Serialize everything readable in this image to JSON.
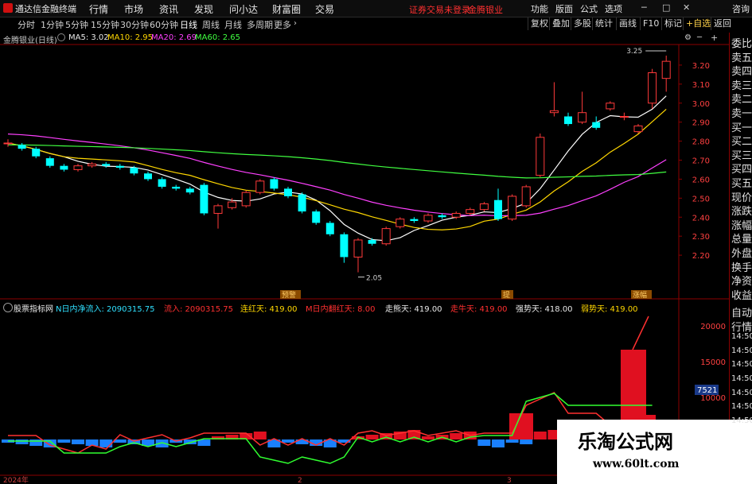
{
  "menubar": {
    "app_title": "通达信金融终端",
    "items": [
      "行情",
      "市场",
      "资讯",
      "发现",
      "问小达",
      "财富圈",
      "交易"
    ],
    "warning": "证券交易未登录",
    "stock_name": "金腾银业",
    "right_items": [
      "功能",
      "版面",
      "公式",
      "选项"
    ],
    "window_controls": [
      "─",
      "□",
      "✕"
    ],
    "right_label": "咨询"
  },
  "toolbar": {
    "periods": [
      "分时",
      "1分钟",
      "5分钟",
      "15分钟",
      "30分钟",
      "60分钟",
      "日线",
      "周线",
      "月线",
      "多周期",
      "更多"
    ],
    "active_period": "日线",
    "tools": [
      "复权",
      "叠加",
      "多股",
      "统计",
      "画线",
      "F10",
      "标记",
      "+自选",
      "返回"
    ]
  },
  "infobar": {
    "title": "金腾银业(日线)",
    "ma5": "MA5: 3.02",
    "ma10": "MA10: 2.95",
    "ma20": "MA20: 2.69",
    "ma60": "MA60: 2.65"
  },
  "price_axis": [
    "3.20",
    "3.10",
    "3.00",
    "2.90",
    "2.80",
    "2.70",
    "2.60",
    "2.50",
    "2.40",
    "2.30",
    "2.20"
  ],
  "annotations": {
    "high": "3.25",
    "low": "2.05",
    "tags": [
      "预警",
      "提",
      "涨幅"
    ]
  },
  "right_panel": [
    "委比",
    "卖五",
    "卖四",
    "卖三",
    "卖二",
    "卖一",
    "买一",
    "买二",
    "买三",
    "买四",
    "买五",
    "现价",
    "涨跌",
    "涨幅",
    "总量",
    "外盘",
    "换手",
    "净资",
    "收益"
  ],
  "indicator": {
    "title": "股票指标网",
    "items": [
      {
        "label": "N日内净流入:",
        "value": "2090315.75",
        "color": "cyan"
      },
      {
        "label": "流入:",
        "value": "2090315.75",
        "color": "red"
      },
      {
        "label": "连红天:",
        "value": "419.00",
        "color": "yel"
      },
      {
        "label": "M日内翻红天:",
        "value": "8.00",
        "color": "red"
      },
      {
        "label": "走熊天:",
        "value": "419.00",
        "color": "wht"
      },
      {
        "label": "走牛天:",
        "value": "419.00",
        "color": "red"
      },
      {
        "label": "强势天:",
        "value": "418.00",
        "color": "wht"
      },
      {
        "label": "弱势天:",
        "value": "419.00",
        "color": "yel"
      }
    ],
    "axis": [
      "20000",
      "15000",
      "10000",
      "5000"
    ],
    "current": "7521"
  },
  "side_panel2": [
    "自动",
    "行情",
    "14:50",
    "14:50",
    "14:50",
    "14:50",
    "14:50",
    "14:50",
    "14:50"
  ],
  "date_axis": [
    "2024年",
    "2",
    "3"
  ],
  "watermark": {
    "line1": "乐淘公式网",
    "line2": "www.60lt.com"
  },
  "chart_data": {
    "type": "candlestick",
    "ylim": [
      2.1,
      3.3
    ],
    "candles": [
      [
        2.79,
        2.79,
        2.81,
        2.77
      ],
      [
        2.78,
        2.76,
        2.79,
        2.75
      ],
      [
        2.76,
        2.72,
        2.77,
        2.71
      ],
      [
        2.71,
        2.67,
        2.72,
        2.66
      ],
      [
        2.67,
        2.65,
        2.68,
        2.64
      ],
      [
        2.65,
        2.67,
        2.68,
        2.64
      ],
      [
        2.67,
        2.68,
        2.69,
        2.66
      ],
      [
        2.68,
        2.67,
        2.69,
        2.66
      ],
      [
        2.67,
        2.66,
        2.68,
        2.65
      ],
      [
        2.66,
        2.63,
        2.67,
        2.62
      ],
      [
        2.63,
        2.6,
        2.64,
        2.59
      ],
      [
        2.6,
        2.56,
        2.61,
        2.55
      ],
      [
        2.56,
        2.55,
        2.57,
        2.54
      ],
      [
        2.55,
        2.53,
        2.56,
        2.52
      ],
      [
        2.57,
        2.42,
        2.58,
        2.41
      ],
      [
        2.42,
        2.46,
        2.47,
        2.34
      ],
      [
        2.45,
        2.48,
        2.5,
        2.44
      ],
      [
        2.46,
        2.53,
        2.54,
        2.45
      ],
      [
        2.53,
        2.59,
        2.6,
        2.52
      ],
      [
        2.6,
        2.55,
        2.61,
        2.54
      ],
      [
        2.55,
        2.51,
        2.56,
        2.5
      ],
      [
        2.52,
        2.43,
        2.53,
        2.42
      ],
      [
        2.43,
        2.37,
        2.44,
        2.36
      ],
      [
        2.37,
        2.31,
        2.38,
        2.3
      ],
      [
        2.31,
        2.19,
        2.32,
        2.16
      ],
      [
        2.19,
        2.28,
        2.29,
        2.11
      ],
      [
        2.28,
        2.26,
        2.29,
        2.25
      ],
      [
        2.26,
        2.34,
        2.35,
        2.25
      ],
      [
        2.35,
        2.39,
        2.4,
        2.34
      ],
      [
        2.39,
        2.38,
        2.4,
        2.37
      ],
      [
        2.38,
        2.41,
        2.42,
        2.37
      ],
      [
        2.41,
        2.4,
        2.42,
        2.39
      ],
      [
        2.4,
        2.42,
        2.43,
        2.39
      ],
      [
        2.42,
        2.44,
        2.45,
        2.41
      ],
      [
        2.44,
        2.47,
        2.48,
        2.43
      ],
      [
        2.49,
        2.39,
        2.55,
        2.38
      ],
      [
        2.39,
        2.51,
        2.52,
        2.38
      ],
      [
        2.46,
        2.56,
        2.57,
        2.45
      ],
      [
        2.62,
        2.82,
        2.84,
        2.61
      ],
      [
        2.95,
        2.96,
        3.11,
        2.93
      ],
      [
        2.93,
        2.89,
        2.95,
        2.88
      ],
      [
        2.9,
        2.95,
        3.06,
        2.89
      ],
      [
        2.9,
        2.87,
        2.93,
        2.86
      ],
      [
        2.97,
        3.0,
        3.01,
        2.96
      ],
      [
        2.93,
        2.93,
        2.95,
        2.91
      ],
      [
        2.85,
        2.88,
        2.89,
        2.84
      ],
      [
        3.0,
        3.16,
        3.18,
        2.97
      ],
      [
        3.13,
        3.22,
        3.25,
        3.06
      ]
    ],
    "ma_colors": {
      "ma5": "#ffffff",
      "ma10": "#ffd700",
      "ma20": "#ff40ff",
      "ma60": "#40ff40"
    }
  }
}
